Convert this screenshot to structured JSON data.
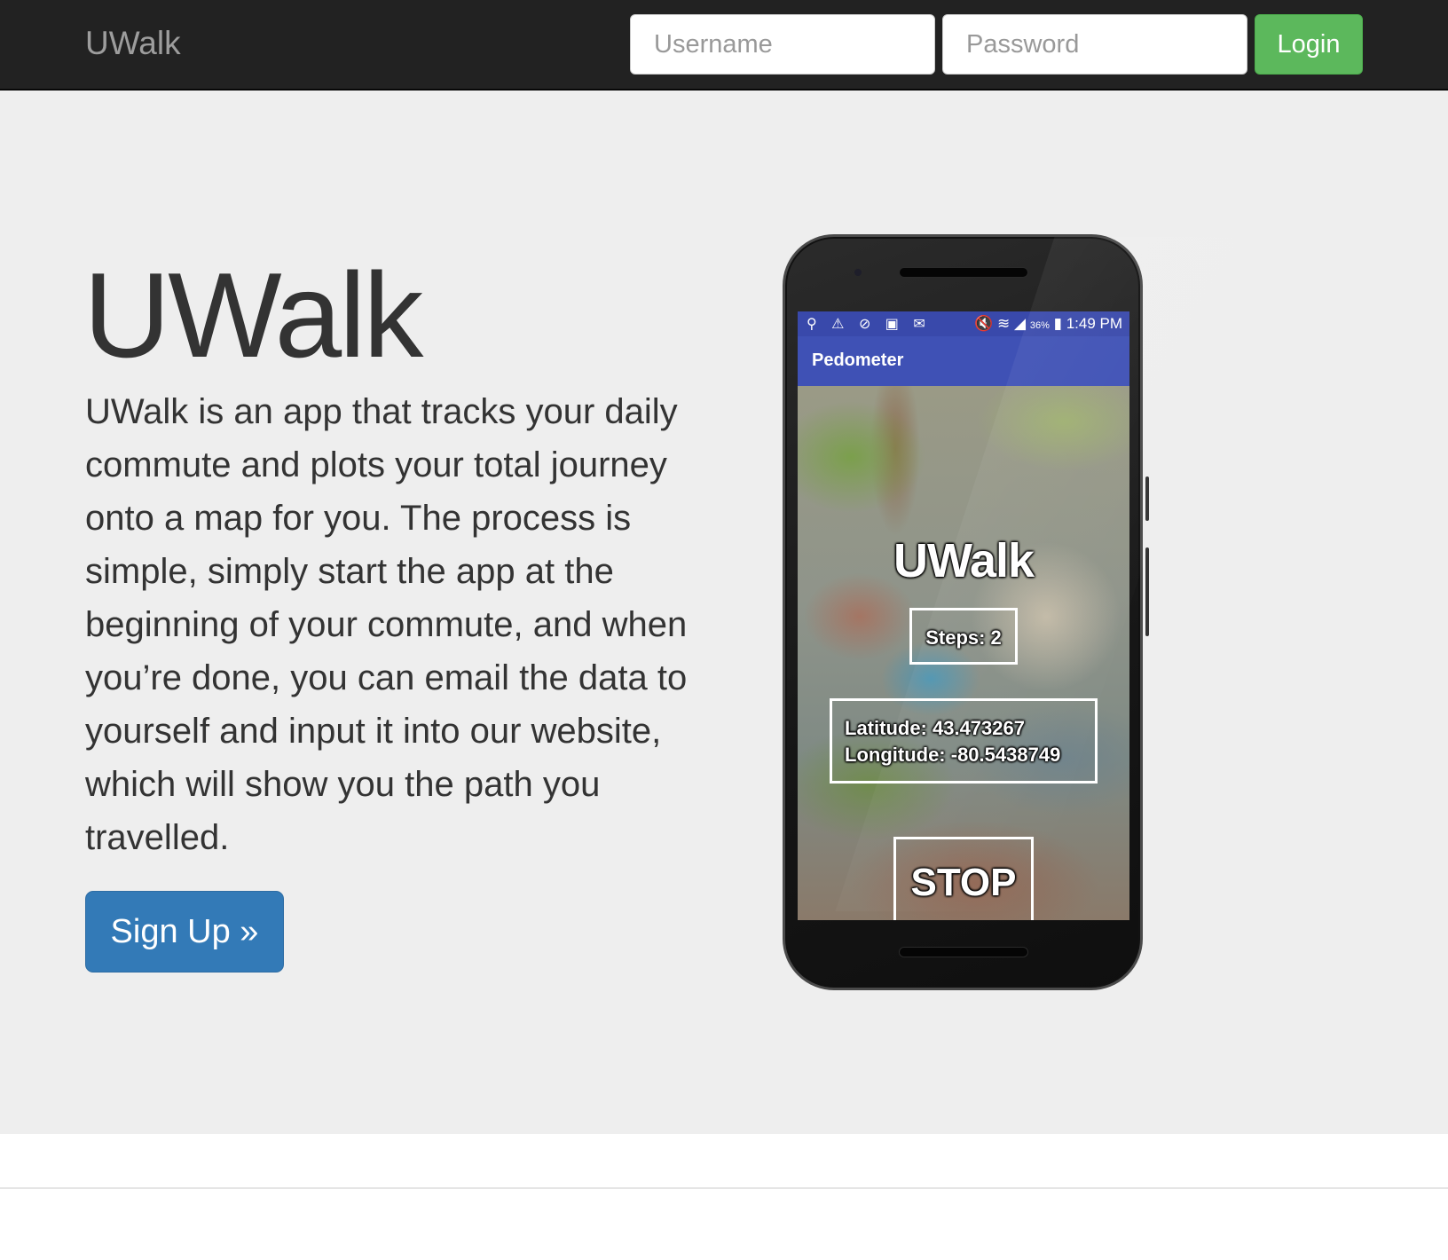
{
  "navbar": {
    "brand": "UWalk",
    "username_placeholder": "Username",
    "password_placeholder": "Password",
    "login_label": "Login"
  },
  "hero": {
    "title": "UWalk",
    "description": "UWalk is an app that tracks your daily commute and plots your total journey onto a map for you. The process is simple, simply start the app at the beginning of your commute, and when you’re done, you can email the data to yourself and input it into our website, which will show you the path you travelled.",
    "signup_label": "Sign Up »"
  },
  "phone": {
    "status_icons": "⚲ ⚠ ⊘ ▣ ✉",
    "status_right_icons": "🔇 ≋ ◢",
    "battery_percent": "36%",
    "battery_icon": "▮",
    "time": "1:49 PM",
    "app_title": "Pedometer",
    "app_name": "UWalk",
    "steps": "Steps: 2",
    "latitude": "Latitude: 43.473267",
    "longitude": "Longitude: -80.5438749",
    "stop_label": "STOP"
  },
  "colors": {
    "navbar_bg": "#222222",
    "login_green": "#5cb85c",
    "signup_blue": "#337ab7",
    "jumbotron_bg": "#eeeeee",
    "app_bar": "#3f51b5"
  }
}
